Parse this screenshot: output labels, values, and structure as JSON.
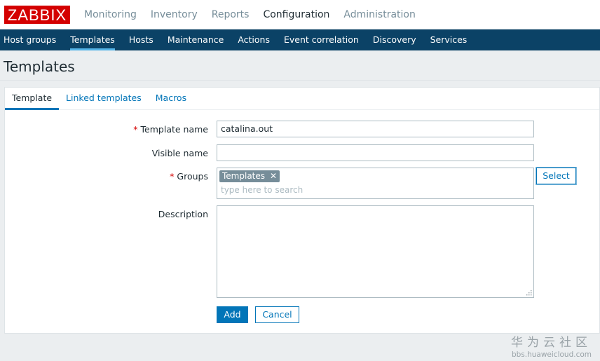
{
  "logo": {
    "text": "ZABBIX"
  },
  "main_menu": {
    "items": [
      {
        "label": "Monitoring"
      },
      {
        "label": "Inventory"
      },
      {
        "label": "Reports"
      },
      {
        "label": "Configuration"
      },
      {
        "label": "Administration"
      }
    ],
    "active": "Configuration"
  },
  "sub_menu": {
    "items": [
      {
        "label": "Host groups"
      },
      {
        "label": "Templates"
      },
      {
        "label": "Hosts"
      },
      {
        "label": "Maintenance"
      },
      {
        "label": "Actions"
      },
      {
        "label": "Event correlation"
      },
      {
        "label": "Discovery"
      },
      {
        "label": "Services"
      }
    ],
    "active": "Templates"
  },
  "page": {
    "title": "Templates"
  },
  "tabs": {
    "items": [
      {
        "label": "Template"
      },
      {
        "label": "Linked templates"
      },
      {
        "label": "Macros"
      }
    ],
    "active": "Template"
  },
  "form": {
    "required_marker": "*",
    "template_name": {
      "label": "Template name",
      "value": "catalina.out"
    },
    "visible_name": {
      "label": "Visible name",
      "value": ""
    },
    "groups": {
      "label": "Groups",
      "chip": "Templates",
      "search_placeholder": "type here to search",
      "select_label": "Select"
    },
    "description": {
      "label": "Description",
      "value": ""
    },
    "add_label": "Add",
    "cancel_label": "Cancel"
  },
  "watermark": {
    "title": "华为云社区",
    "url": "bbs.huaweicloud.com"
  },
  "colors": {
    "brand_red": "#d40000",
    "nav_dark": "#0b4266",
    "accent_blue": "#0275b8",
    "active_underline": "#54b3e7"
  },
  "icons": {
    "remove_chip": "close-icon",
    "resize": "resize-grip-icon"
  }
}
